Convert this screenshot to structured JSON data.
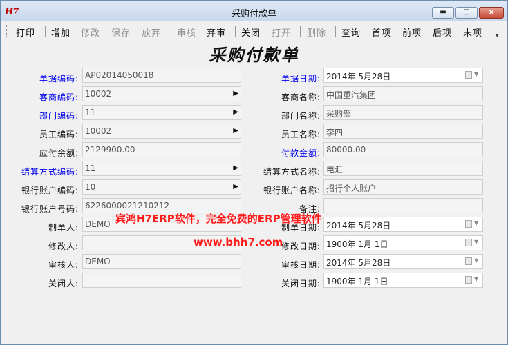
{
  "window": {
    "logo": "H7",
    "title": "采购付款单",
    "min": "▬",
    "max": "□",
    "close": "✕"
  },
  "toolbar": {
    "print": "打印",
    "add": "增加",
    "edit": "修改",
    "save": "保存",
    "discard": "放弃",
    "approve": "审核",
    "unapprove": "弃审",
    "close_doc": "关闭",
    "open_doc": "打开",
    "delete": "删除",
    "query": "查询",
    "first": "首项",
    "prev": "前项",
    "next": "后项",
    "last": "末项",
    "overflow": "▾"
  },
  "form": {
    "heading": "采购付款单",
    "doc_no": {
      "label": "单据编码:",
      "value": "AP02014050018"
    },
    "doc_date": {
      "label": "单据日期:",
      "value": "2014年 5月28日"
    },
    "customer_code": {
      "label": "客商编码:",
      "value": "10002"
    },
    "customer_name": {
      "label": "客商名称:",
      "value": "中国重汽集团"
    },
    "dept_code": {
      "label": "部门编码:",
      "value": "11"
    },
    "dept_name": {
      "label": "部门名称:",
      "value": "采购部"
    },
    "emp_code": {
      "label": "员工编码:",
      "value": "10002"
    },
    "emp_name": {
      "label": "员工名称:",
      "value": "李四"
    },
    "payable_balance": {
      "label": "应付余额:",
      "value": "2129900.00"
    },
    "payment_amount": {
      "label": "付款金额:",
      "value": "80000.00"
    },
    "settle_code": {
      "label": "结算方式编码:",
      "value": "11"
    },
    "settle_name": {
      "label": "结算方式名称:",
      "value": "电汇"
    },
    "bank_code": {
      "label": "银行账户编码:",
      "value": "10"
    },
    "bank_name": {
      "label": "银行账户名称:",
      "value": "招行个人账户"
    },
    "bank_no": {
      "label": "银行账户号码:",
      "value": "6226000021210212"
    },
    "remark": {
      "label": "备注:",
      "value": ""
    },
    "creator": {
      "label": "制单人:",
      "value": "DEMO"
    },
    "create_date": {
      "label": "制单日期:",
      "value": "2014年 5月28日"
    },
    "modifier": {
      "label": "修改人:",
      "value": ""
    },
    "modify_date": {
      "label": "修改日期:",
      "value": "1900年 1月 1日"
    },
    "auditor": {
      "label": "审核人:",
      "value": "DEMO"
    },
    "audit_date": {
      "label": "审核日期:",
      "value": "2014年 5月28日"
    },
    "closer": {
      "label": "关闭人:",
      "value": ""
    },
    "close_date": {
      "label": "关闭日期:",
      "value": "1900年 1月 1日"
    },
    "lookup_arrow": "▶"
  },
  "watermark": {
    "line1": "宾鸿H7ERP软件，完全免费的ERP管理软件",
    "line2": "www.bhh7.com"
  }
}
